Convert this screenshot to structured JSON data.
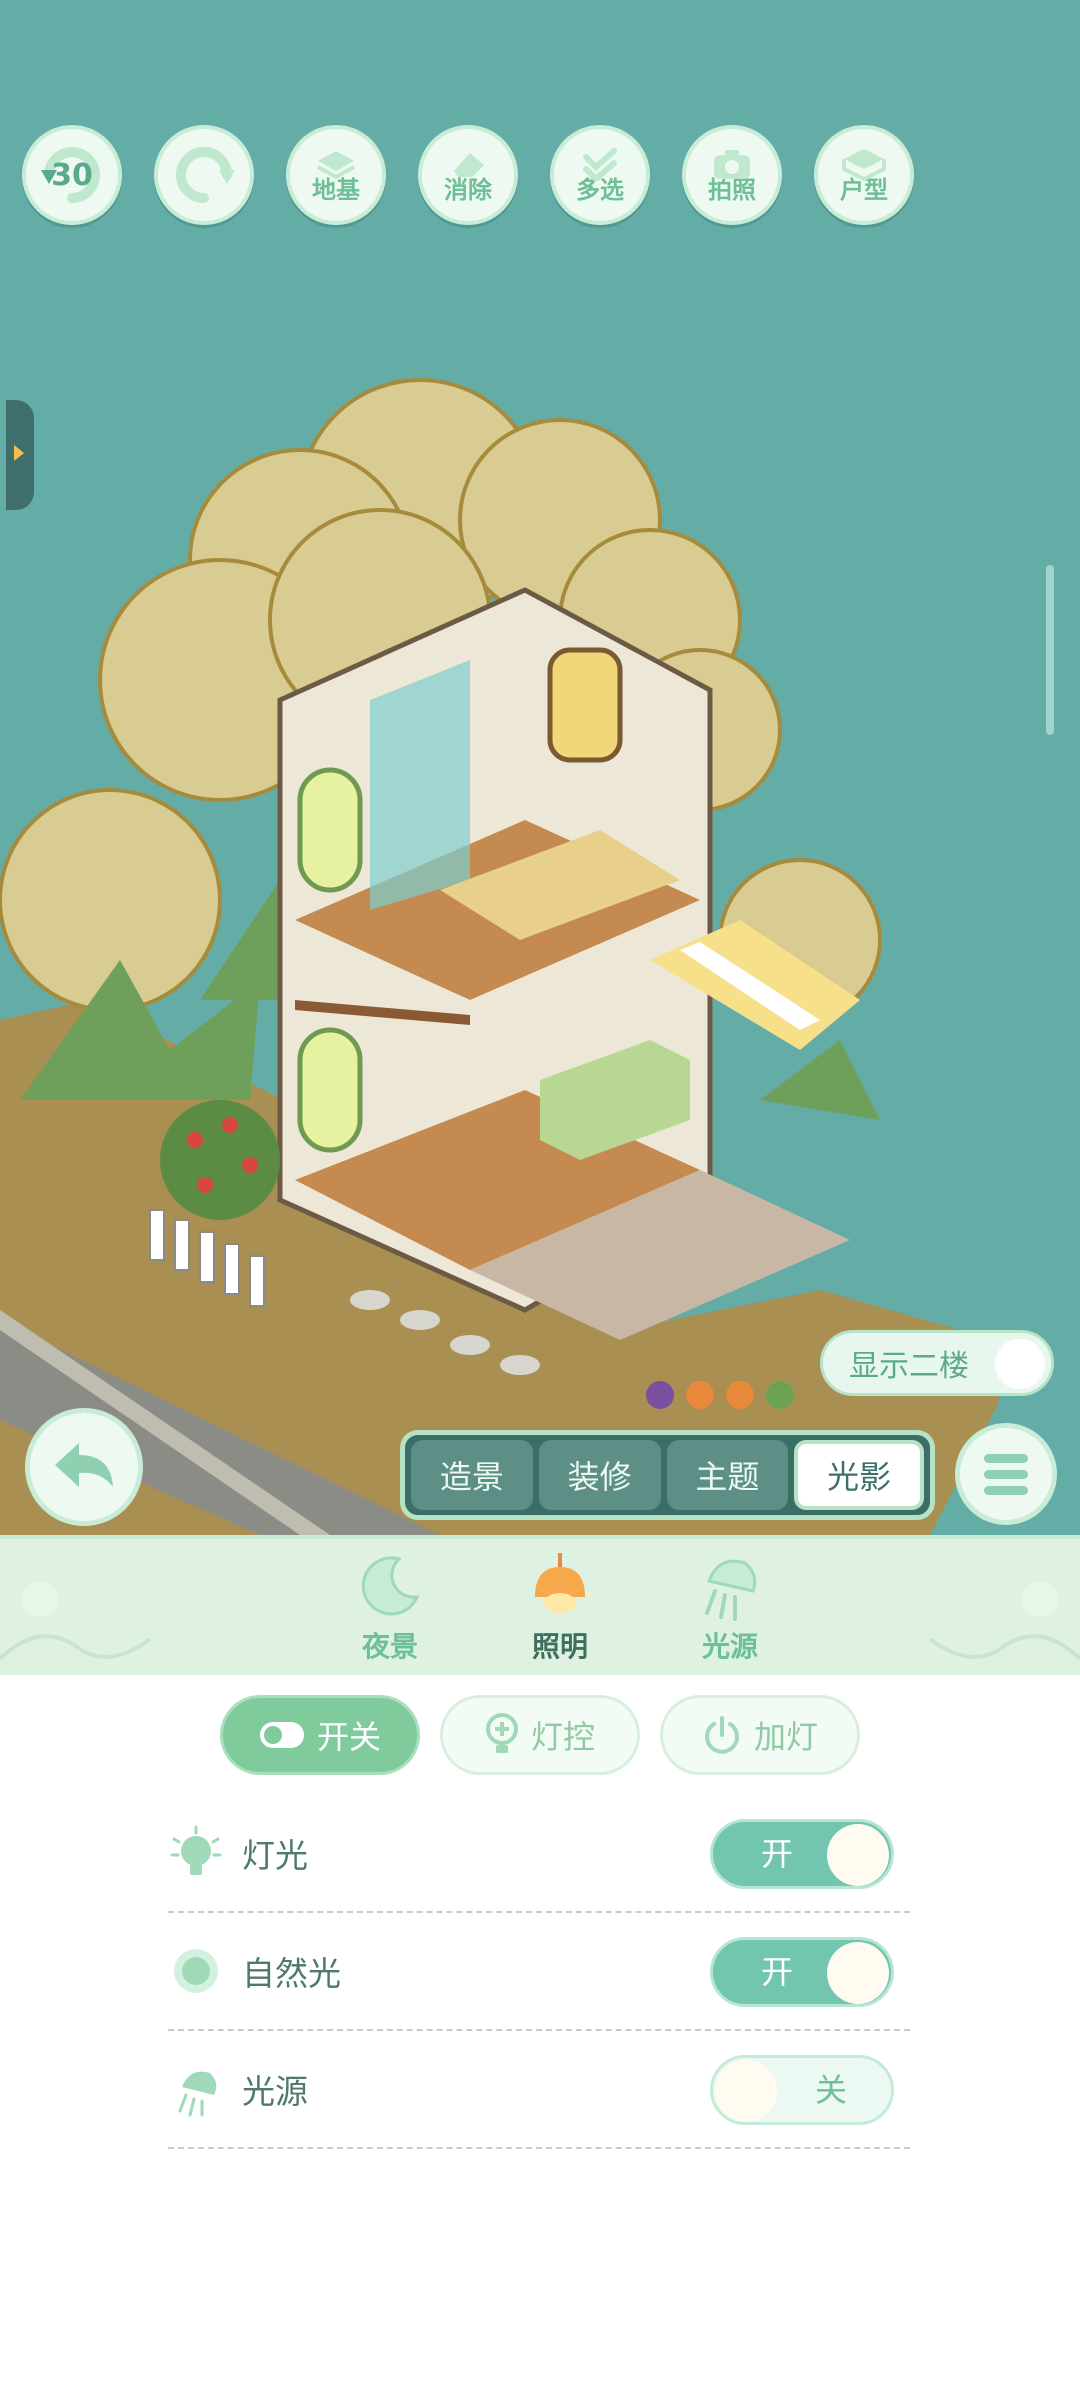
{
  "toolbar": {
    "undo_count": "30",
    "redo_label": "",
    "foundation_label": "地基",
    "erase_label": "消除",
    "multiselect_label": "多选",
    "photo_label": "拍照",
    "floorplan_label": "户型"
  },
  "scene": {
    "show_second_floor_label": "显示二楼",
    "show_second_floor_on": false
  },
  "categories": [
    {
      "label": "造景",
      "active": false
    },
    {
      "label": "装修",
      "active": false
    },
    {
      "label": "主题",
      "active": false
    },
    {
      "label": "光影",
      "active": true
    }
  ],
  "subtabs": [
    {
      "label": "夜景",
      "icon": "moon-icon"
    },
    {
      "label": "照明",
      "icon": "lamp-icon",
      "active": true
    },
    {
      "label": "光源",
      "icon": "light-source-icon"
    }
  ],
  "pills": [
    {
      "label": "开关",
      "icon": "toggle-icon",
      "active": true
    },
    {
      "label": "灯控",
      "icon": "bulb-icon",
      "active": false
    },
    {
      "label": "加灯",
      "icon": "power-icon",
      "active": false
    }
  ],
  "settings": [
    {
      "label": "灯光",
      "icon": "light-bulb-icon",
      "state": "开",
      "on": true
    },
    {
      "label": "自然光",
      "icon": "sun-icon",
      "state": "开",
      "on": true
    },
    {
      "label": "光源",
      "icon": "light-source-icon",
      "state": "关",
      "on": false
    }
  ],
  "colors": {
    "water": "#64ada7",
    "accent_green": "#7fcb9c",
    "toggle_on": "#72c6b0",
    "panel_bg": "#dff2e2"
  }
}
